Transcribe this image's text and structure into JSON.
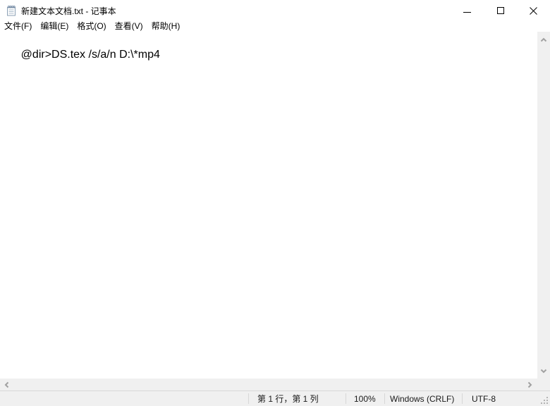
{
  "window": {
    "title": "新建文本文档.txt - 记事本"
  },
  "menu": {
    "items": [
      "文件(F)",
      "编辑(E)",
      "格式(O)",
      "查看(V)",
      "帮助(H)"
    ]
  },
  "editor": {
    "content": "@dir>DS.tex /s/a/n D:\\*mp4"
  },
  "status_bar": {
    "cursor_position": "第 1 行，第 1 列",
    "zoom_level": "100%",
    "line_ending": "Windows (CRLF)",
    "encoding": "UTF-8"
  },
  "icons": {
    "app": "notepad-icon",
    "minimize": "minimize-icon",
    "maximize": "maximize-icon",
    "close": "close-icon",
    "scroll_up": "chevron-up-icon",
    "scroll_down": "chevron-down-icon",
    "scroll_left": "chevron-left-icon",
    "scroll_right": "chevron-right-icon",
    "resize": "resize-grip-icon"
  },
  "colors": {
    "titlebar_bg": "#ffffff",
    "window_bg": "#ffffff",
    "scrollbar_track": "#f0f0f0",
    "scrollbar_arrow": "#a1a1a1",
    "statusbar_bg": "#f0f0f0",
    "divider": "#d7d7d7",
    "text": "#000000"
  }
}
